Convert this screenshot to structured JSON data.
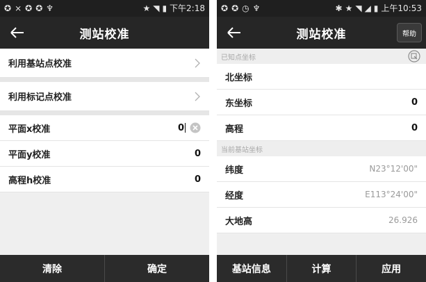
{
  "left": {
    "status": {
      "time": "下午2:18"
    },
    "title": "测站校准",
    "nav_items": [
      {
        "label": "利用基站点校准"
      },
      {
        "label": "利用标记点校准"
      }
    ],
    "fields": [
      {
        "label": "平面x校准",
        "value": "0"
      },
      {
        "label": "平面y校准",
        "value": "0"
      },
      {
        "label": "高程h校准",
        "value": "0"
      }
    ],
    "buttons": {
      "clear": "清除",
      "confirm": "确定"
    }
  },
  "right": {
    "status": {
      "time": "上午10:53"
    },
    "title": "测站校准",
    "help_label": "帮助",
    "known_section": "已知点坐标",
    "known_fields": [
      {
        "label": "北坐标",
        "value": ""
      },
      {
        "label": "东坐标",
        "value": "0"
      },
      {
        "label": "高程",
        "value": "0"
      }
    ],
    "current_section": "当前基站坐标",
    "current_fields": [
      {
        "label": "纬度",
        "value": "N23°12'00\""
      },
      {
        "label": "经度",
        "value": "E113°24'00\""
      },
      {
        "label": "大地高",
        "value": "26.926"
      }
    ],
    "buttons": {
      "base_info": "基站信息",
      "calculate": "计算",
      "apply": "应用"
    }
  }
}
